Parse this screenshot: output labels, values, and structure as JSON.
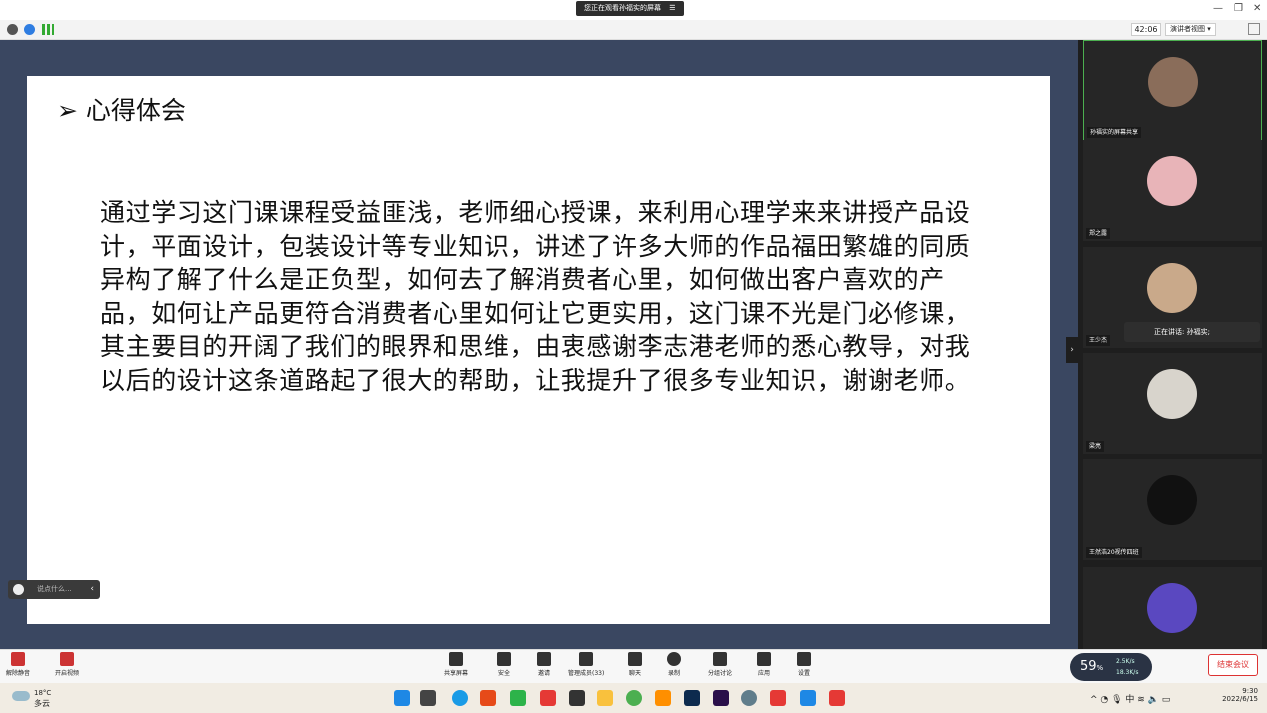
{
  "banner": {
    "text": "您正在观看孙福实的屏幕",
    "menu_icon": "menu-icon"
  },
  "window": {
    "minimize": "—",
    "restore": "❐",
    "close": "✕"
  },
  "status": {
    "timer": "42:06",
    "presenter_view": "演讲者视图 ▾"
  },
  "slide": {
    "title": "➢ 心得体会",
    "body": "通过学习这门课课程受益匪浅，老师细心授课，来利用心理学来来讲授产品设计，平面设计，包装设计等专业知识，讲述了许多大师的作品福田繁雄的同质异构了解了什么是正负型，如何去了解消费者心里，如何做出客户喜欢的产品，如何让产品更符合消费者心里如何让它更实用，这门课不光是门必修课，其主要目的开阔了我们的眼界和思维，由衷感谢李志港老师的悉心教导，对我以后的设计这条道路起了很大的帮助，让我提升了很多专业知识，谢谢老师。"
  },
  "chat_pill": {
    "placeholder": "说点什么...",
    "arrow": "‹"
  },
  "participants": [
    {
      "name": "孙福实的屏幕共享",
      "color": "#8a6d5a",
      "active": true
    },
    {
      "name": "郑之露",
      "color": "#e8b4b8"
    },
    {
      "name": "王少杰",
      "color": "#c9a98a"
    },
    {
      "name": "梁亮",
      "color": "#d8d4cc"
    },
    {
      "name": "王然浩20视传四班",
      "color": "#111111"
    },
    {
      "name": "",
      "color": "#5a48c0"
    }
  ],
  "speaking": {
    "text": "正在讲话: 孙福实;"
  },
  "collapse": "›",
  "toolbar": {
    "items": [
      {
        "label": "解除静音"
      },
      {
        "label": "开启视频"
      },
      {
        "label": "共享屏幕"
      },
      {
        "label": "安全"
      },
      {
        "label": "邀请"
      },
      {
        "label": "管理成员(33)"
      },
      {
        "label": "聊天"
      },
      {
        "label": "录制"
      },
      {
        "label": "分组讨论"
      },
      {
        "label": "应用"
      },
      {
        "label": "设置"
      }
    ]
  },
  "network": {
    "percent": "59",
    "unit": "%",
    "up": "2.5K/s",
    "down": "18.3K/s"
  },
  "end_meeting": "结束会议",
  "taskbar": {
    "weather_temp": "18°C",
    "weather_cond": "多云",
    "tray": "^ ◔ 🎙 中 ≋ 🔈 ▭",
    "time": "9:30",
    "date": "2022/6/15"
  }
}
